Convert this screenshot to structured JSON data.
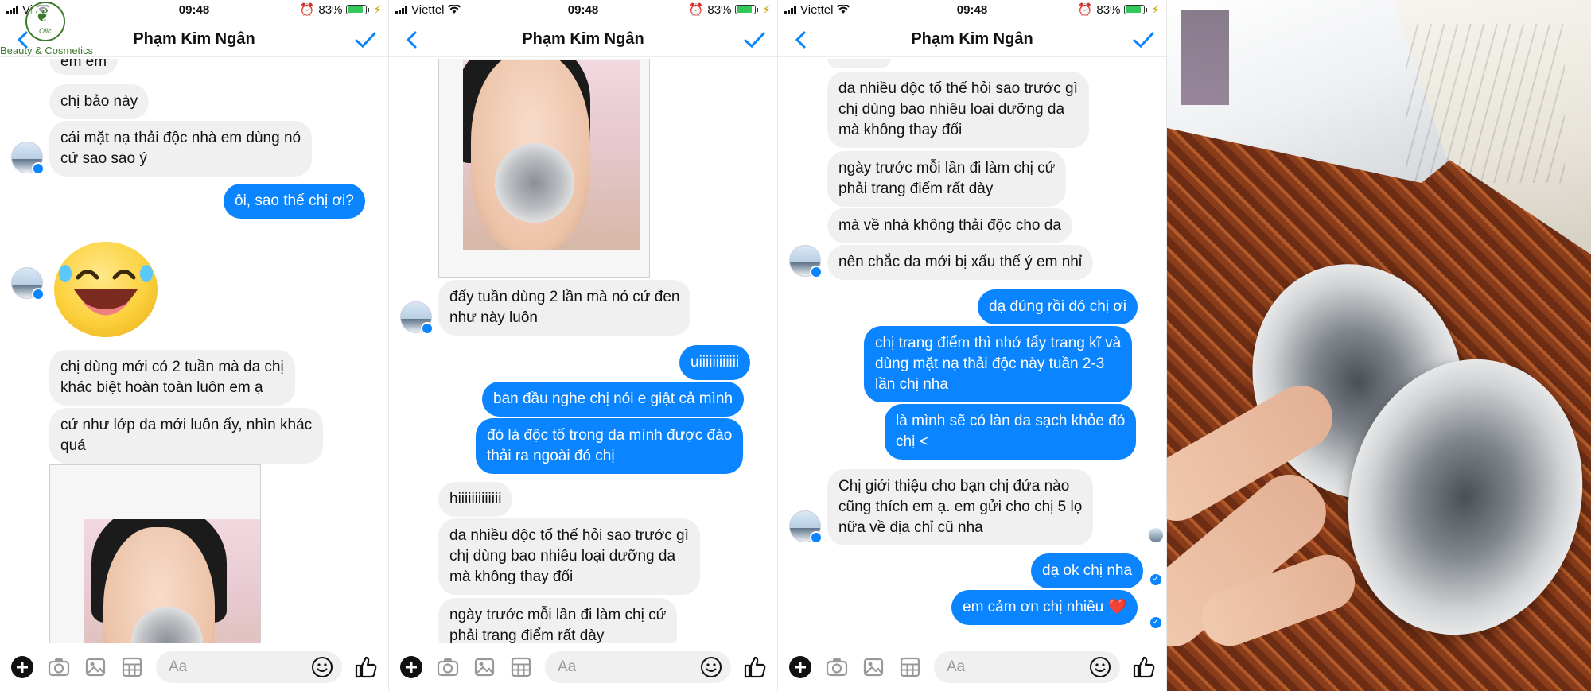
{
  "colors": {
    "accent": "#0a84ff",
    "incoming_bubble": "#f0f0f0",
    "battery_fill": "#34c759"
  },
  "watermark": {
    "mark": "Olic",
    "text": "Beauty & Cosmetics"
  },
  "screens": [
    {
      "status": {
        "carrier": "Vi",
        "time": "09:48",
        "battery": "83%",
        "battery_level": 0.83
      },
      "nav": {
        "title": "Phạm Kim Ngân"
      },
      "composer": {
        "placeholder": "Aa"
      },
      "messages": [
        {
          "dir": "in",
          "text": "em em"
        },
        {
          "dir": "in",
          "text": "chị bảo này"
        },
        {
          "dir": "in",
          "text": "cái mặt nạ thải độc nhà em dùng nó\ncứ sao sao ý"
        },
        {
          "dir": "out",
          "text": "ôi, sao thế chị ơi?"
        },
        {
          "dir": "in",
          "text": "emoji",
          "icon": "laughing-emoji-icon"
        },
        {
          "dir": "in",
          "text": "chị dùng mới có 2 tuần mà da chị\nkhác biệt hoàn toàn luôn em ạ"
        },
        {
          "dir": "in",
          "text": "cứ như lớp da mới luôn ấy, nhìn khác\nquá"
        },
        {
          "dir": "in",
          "text": "photo"
        }
      ]
    },
    {
      "status": {
        "carrier": "Viettel",
        "time": "09:48",
        "battery": "83%",
        "battery_level": 0.83
      },
      "nav": {
        "title": "Phạm Kim Ngân"
      },
      "composer": {
        "placeholder": "Aa"
      },
      "messages": [
        {
          "dir": "in",
          "text": "photo"
        },
        {
          "dir": "in",
          "text": "đấy tuần dùng 2 lần mà nó cứ đen\nnhư này luôn"
        },
        {
          "dir": "out",
          "text": "uiiiiiiiiiiii"
        },
        {
          "dir": "out",
          "text": "ban đầu nghe chị nói e giật cả mình"
        },
        {
          "dir": "out",
          "text": "đó là độc tố trong da mình được đào\nthải ra ngoài đó chị"
        },
        {
          "dir": "in",
          "text": "hiiiiiiiiiiiii"
        },
        {
          "dir": "in",
          "text": "da nhiều độc tố thế hỏi sao trước gì\nchị dùng bao nhiêu loại dưỡng da\nmà không thay đổi"
        },
        {
          "dir": "in",
          "text": "ngày trước mỗi lần đi làm chị cứ\nphải trang điểm rất dày"
        }
      ]
    },
    {
      "status": {
        "carrier": "Viettel",
        "time": "09:48",
        "battery": "83%",
        "battery_level": 0.83
      },
      "nav": {
        "title": "Phạm Kim Ngân"
      },
      "composer": {
        "placeholder": "Aa"
      },
      "messages": [
        {
          "dir": "in",
          "text": "da nhiều độc tố thế hỏi sao trước gì\nchị dùng bao nhiêu loại dưỡng da\nmà không thay đổi"
        },
        {
          "dir": "in",
          "text": "ngày trước mỗi lần đi làm chị cứ\nphải trang điểm rất dày"
        },
        {
          "dir": "in",
          "text": "mà về nhà không thải độc cho da"
        },
        {
          "dir": "in",
          "text": "nên chắc da mới bị xấu thế ý em nhỉ"
        },
        {
          "dir": "out",
          "text": "dạ đúng rồi đó chị ơi"
        },
        {
          "dir": "out",
          "text": "chị trang điểm thì nhớ tẩy trang kĩ và\ndùng mặt nạ thải độc này tuần 2-3\nlần chị nha"
        },
        {
          "dir": "out",
          "text": "là mình sẽ có làn da sạch khỏe đó\nchị <"
        },
        {
          "dir": "in",
          "text": "Chị giới thiệu cho bạn chị đứa nào\ncũng thích em ạ. em gửi cho chị 5 lọ\nnữa về địa chỉ cũ nha"
        },
        {
          "dir": "out",
          "text": "dạ ok chị nha"
        },
        {
          "dir": "out",
          "text": "em cảm ơn chị nhiều ❤️"
        }
      ]
    }
  ]
}
